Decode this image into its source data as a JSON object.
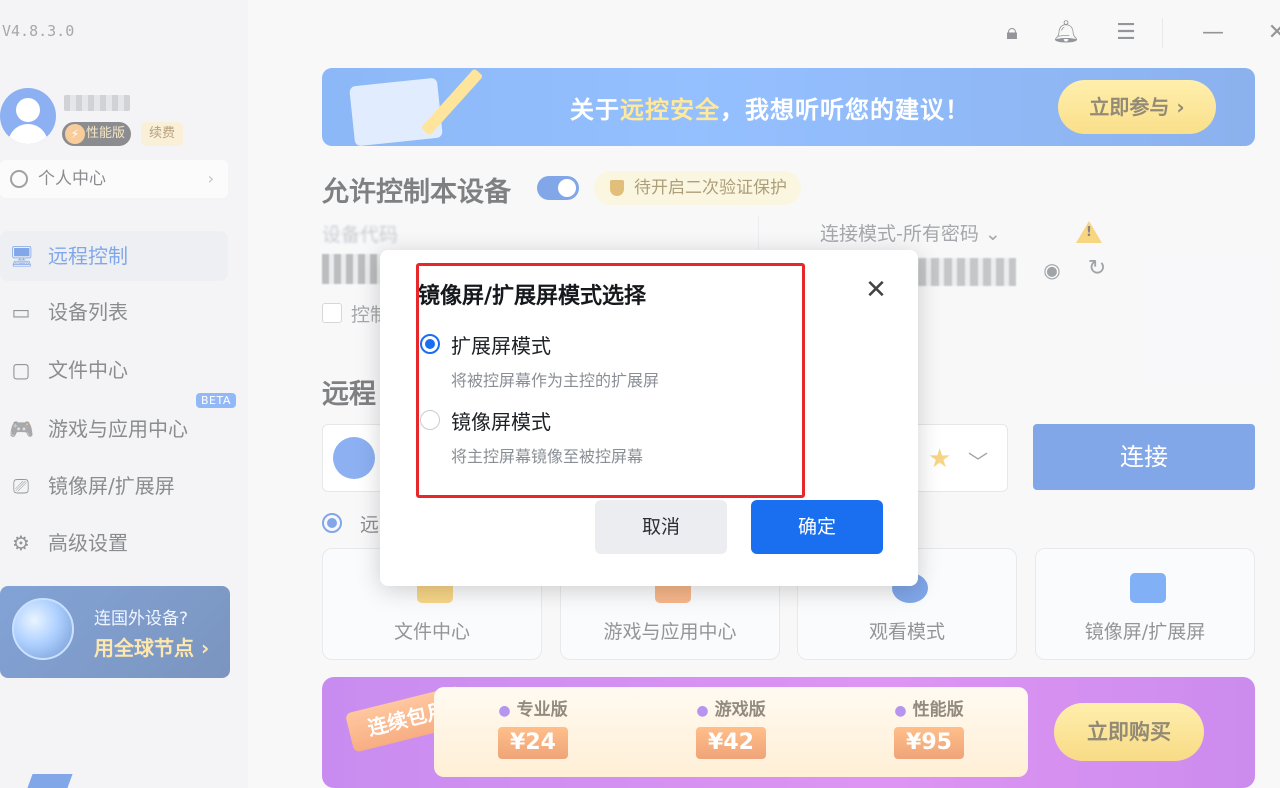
{
  "app": {
    "version": "V4.8.3.0"
  },
  "user": {
    "tier_badge": "性能版",
    "renew_badge": "续费",
    "personal_center": "个人中心"
  },
  "sidebar": {
    "items": [
      {
        "label": "远程控制",
        "icon": "monitor-icon",
        "active": true
      },
      {
        "label": "设备列表",
        "icon": "devices-icon"
      },
      {
        "label": "文件中心",
        "icon": "folder-icon"
      },
      {
        "label": "游戏与应用中心",
        "icon": "gamepad-icon"
      },
      {
        "label": "镜像屏/扩展屏",
        "icon": "cast-icon"
      },
      {
        "label": "高级设置",
        "icon": "gear-icon"
      }
    ],
    "beta_label": "BETA",
    "global_promo": {
      "line1": "连国外设备?",
      "line2": "用全球节点 ›"
    }
  },
  "banner": {
    "text_prefix": "关于",
    "text_highlight": "远控安全",
    "text_suffix": "，我想听听您的建议！",
    "button": "立即参与 ›"
  },
  "allow": {
    "title": "允许控制本设备",
    "verify_badge": "待开启二次验证保护"
  },
  "device": {
    "code_label": "设备代码",
    "ctrl_label": "控制",
    "conn_mode": "连接模式-所有密码 ⌄"
  },
  "remote": {
    "title": "远程",
    "connect_button": "连接",
    "radio_label": "远"
  },
  "tiles": [
    {
      "label": "文件中心",
      "color": "#f0b323"
    },
    {
      "label": "游戏与应用中心",
      "color": "#f07a2a"
    },
    {
      "label": "观看模式",
      "color": "#1a5fd8"
    },
    {
      "label": "镜像屏/扩展屏",
      "color": "#1a6ff0"
    }
  ],
  "promo": {
    "ribbon": "连续包月",
    "plans": [
      {
        "name": "专业版",
        "price": "¥24"
      },
      {
        "name": "游戏版",
        "price": "¥42"
      },
      {
        "name": "性能版",
        "price": "¥95"
      }
    ],
    "buy_button": "立即购买"
  },
  "dialog": {
    "title": "镜像屏/扩展屏模式选择",
    "options": [
      {
        "label": "扩展屏模式",
        "desc": "将被控屏幕作为主控的扩展屏",
        "selected": true
      },
      {
        "label": "镜像屏模式",
        "desc": "将主控屏幕镜像至被控屏幕",
        "selected": false
      }
    ],
    "cancel": "取消",
    "confirm": "确定"
  },
  "colors": {
    "accent": "#1a5fd8",
    "highlight_box": "#e8272b",
    "warning": "#f1b21b"
  }
}
